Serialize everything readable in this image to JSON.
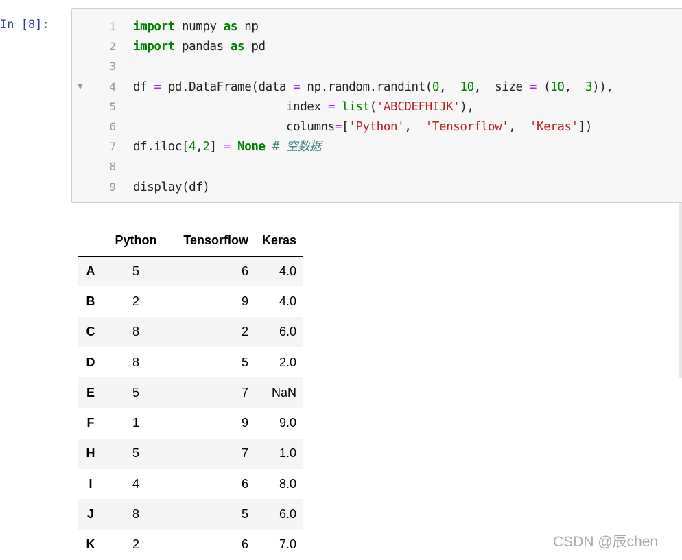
{
  "prompt": "In  [8]:",
  "code": {
    "line_numbers": [
      "1",
      "2",
      "3",
      "4",
      "5",
      "6",
      "7",
      "8",
      "9"
    ],
    "lines": [
      [
        {
          "t": "import",
          "c": "kw"
        },
        {
          "t": " numpy ",
          "c": ""
        },
        {
          "t": "as",
          "c": "kw"
        },
        {
          "t": " np",
          "c": ""
        }
      ],
      [
        {
          "t": "import",
          "c": "kw"
        },
        {
          "t": " pandas ",
          "c": ""
        },
        {
          "t": "as",
          "c": "kw"
        },
        {
          "t": " pd",
          "c": ""
        }
      ],
      [],
      [
        {
          "t": "df ",
          "c": ""
        },
        {
          "t": "=",
          "c": "op"
        },
        {
          "t": " pd.DataFrame(data ",
          "c": ""
        },
        {
          "t": "=",
          "c": "op"
        },
        {
          "t": " np.random.randint(",
          "c": ""
        },
        {
          "t": "0",
          "c": "num"
        },
        {
          "t": ",  ",
          "c": ""
        },
        {
          "t": "10",
          "c": "num"
        },
        {
          "t": ",  size ",
          "c": ""
        },
        {
          "t": "=",
          "c": "op"
        },
        {
          "t": " (",
          "c": ""
        },
        {
          "t": "10",
          "c": "num"
        },
        {
          "t": ",  ",
          "c": ""
        },
        {
          "t": "3",
          "c": "num"
        },
        {
          "t": ")),",
          "c": ""
        }
      ],
      [
        {
          "t": "                      index ",
          "c": ""
        },
        {
          "t": "=",
          "c": "op"
        },
        {
          "t": " ",
          "c": ""
        },
        {
          "t": "list",
          "c": "num"
        },
        {
          "t": "(",
          "c": ""
        },
        {
          "t": "'ABCDEFHIJK'",
          "c": "str"
        },
        {
          "t": "),",
          "c": ""
        }
      ],
      [
        {
          "t": "                      columns",
          "c": ""
        },
        {
          "t": "=",
          "c": "op"
        },
        {
          "t": "[",
          "c": ""
        },
        {
          "t": "'Python'",
          "c": "str"
        },
        {
          "t": ",  ",
          "c": ""
        },
        {
          "t": "'Tensorflow'",
          "c": "str"
        },
        {
          "t": ",  ",
          "c": ""
        },
        {
          "t": "'Keras'",
          "c": "str"
        },
        {
          "t": "])",
          "c": ""
        }
      ],
      [
        {
          "t": "df.iloc[",
          "c": ""
        },
        {
          "t": "4",
          "c": "num"
        },
        {
          "t": ",",
          "c": ""
        },
        {
          "t": "2",
          "c": "num"
        },
        {
          "t": "] ",
          "c": ""
        },
        {
          "t": "=",
          "c": "op"
        },
        {
          "t": " ",
          "c": ""
        },
        {
          "t": "None",
          "c": "kw"
        },
        {
          "t": " ",
          "c": ""
        },
        {
          "t": "# 空数据",
          "c": "cm"
        }
      ],
      [],
      [
        {
          "t": "display(df)",
          "c": ""
        }
      ]
    ]
  },
  "table": {
    "columns": [
      "Python",
      "Tensorflow",
      "Keras"
    ],
    "rows": [
      {
        "index": "A",
        "values": [
          "5",
          "6",
          "4.0"
        ]
      },
      {
        "index": "B",
        "values": [
          "2",
          "9",
          "4.0"
        ]
      },
      {
        "index": "C",
        "values": [
          "8",
          "2",
          "6.0"
        ]
      },
      {
        "index": "D",
        "values": [
          "8",
          "5",
          "2.0"
        ]
      },
      {
        "index": "E",
        "values": [
          "5",
          "7",
          "NaN"
        ]
      },
      {
        "index": "F",
        "values": [
          "1",
          "9",
          "9.0"
        ]
      },
      {
        "index": "H",
        "values": [
          "5",
          "7",
          "1.0"
        ]
      },
      {
        "index": "I",
        "values": [
          "4",
          "6",
          "8.0"
        ]
      },
      {
        "index": "J",
        "values": [
          "8",
          "5",
          "6.0"
        ]
      },
      {
        "index": "K",
        "values": [
          "2",
          "6",
          "7.0"
        ]
      }
    ]
  },
  "watermark": "CSDN @辰chen",
  "colors": {
    "prompt": "#303f9f",
    "keyword": "#008000",
    "string": "#ba2121",
    "operator": "#aa22ff",
    "comment": "#408080"
  }
}
